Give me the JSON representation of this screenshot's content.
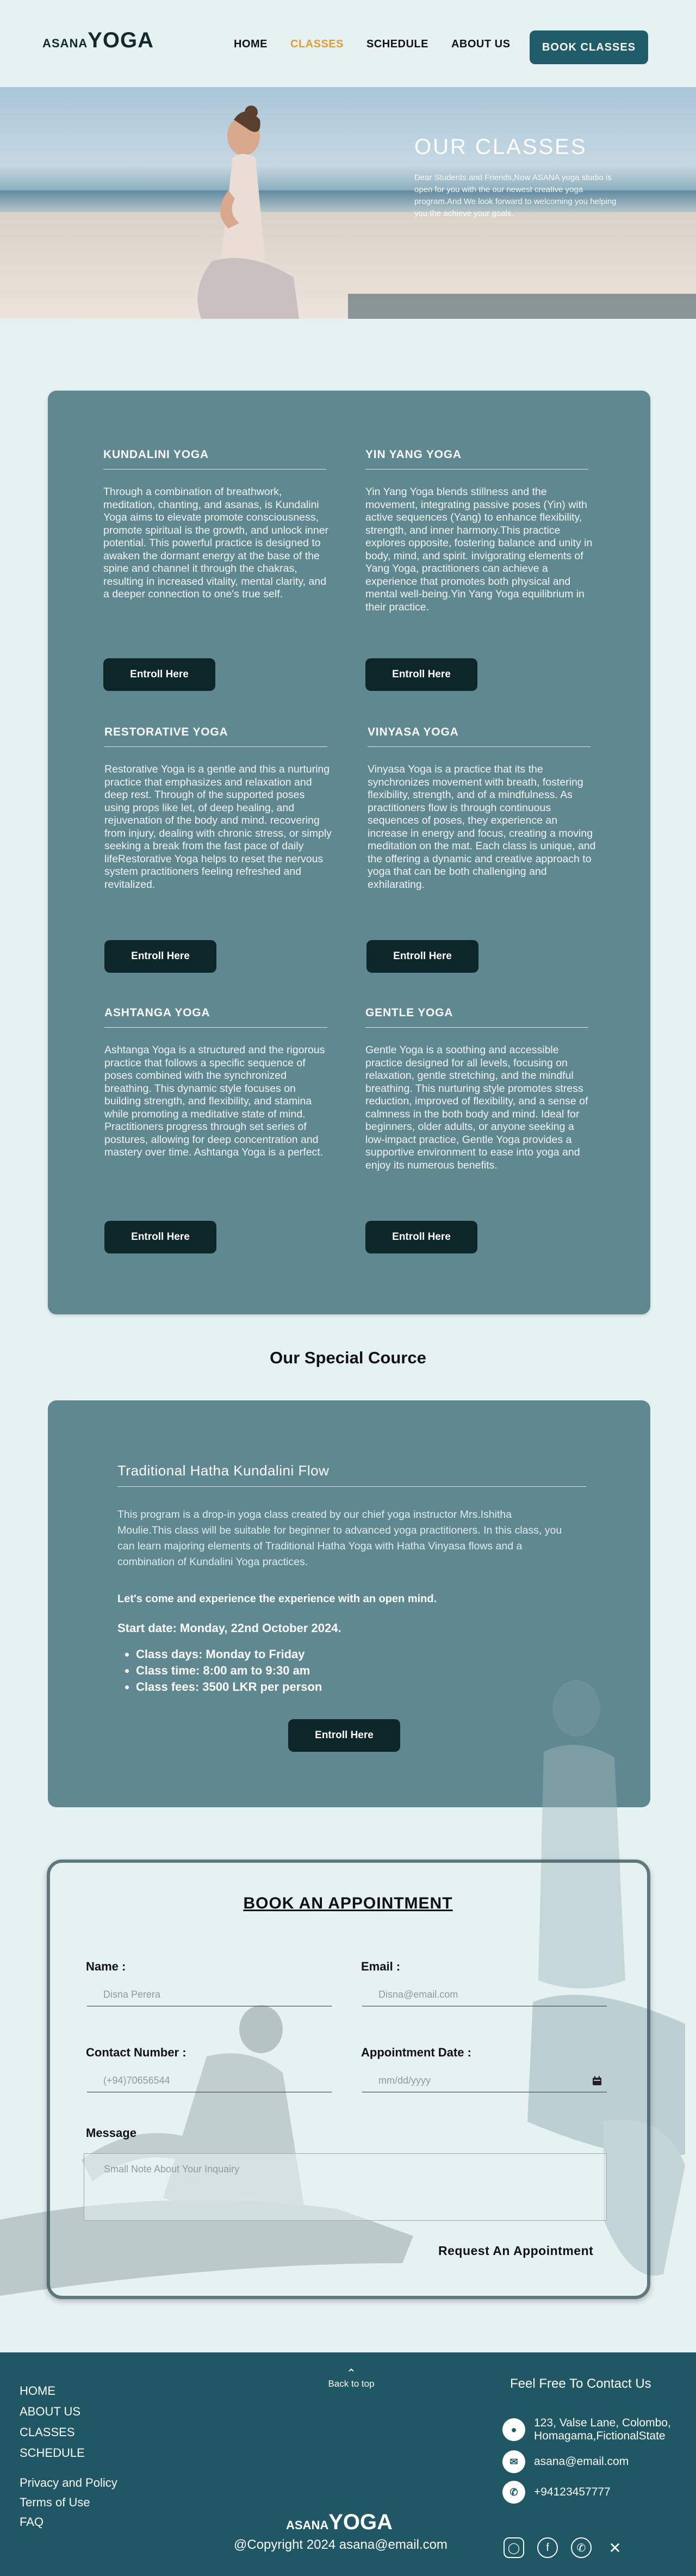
{
  "brand": {
    "small": "ASANA",
    "big": "YOGA"
  },
  "nav": {
    "items": [
      "HOME",
      "CLASSES",
      "SCHEDULE",
      "ABOUT US"
    ],
    "active": "CLASSES",
    "book": "BOOK  CLASSES"
  },
  "hero": {
    "title": "OUR  CLASSES",
    "text": "Dear Students and Friends,Now ASANA yoga studio is open for you with the our newest creative yoga program.And  We look forward to welcoming you helping you  the achieve your goals."
  },
  "classes": [
    {
      "name": "KUNDALINI YOGA",
      "desc": "Through a combination of breathwork, meditation, chanting, and asanas,  is Kundalini Yoga aims to elevate promote consciousness, promote spiritual  is the growth, and unlock inner potential. This powerful practice is designed to awaken the dormant energy at the base of the spine and channel it through the chakras, resulting in increased vitality, mental clarity, and a deeper connection to one's true self.",
      "button": "Entroll Here"
    },
    {
      "name": "YIN YANG YOGA",
      "desc": "Yin Yang Yoga blends stillness and the movement, integrating passive poses (Yin) with active sequences (Yang) to enhance flexibility, strength, and inner harmony.This practice explores opposite, fostering balance and unity in body, mind, and spirit.  invigorating elements of Yang Yoga, practitioners can achieve a experience that promotes both physical and mental well-being.Yin Yang Yoga equilibrium in their practice.",
      "button": "Entroll Here"
    },
    {
      "name": "RESTORATIVE YOGA",
      "desc": "Restorative Yoga is a gentle and this a nurturing practice that emphasizes  and relaxation and deep rest. Through of the supported poses using props like let, of deep healing, and rejuvenation of the body and mind.  recovering from injury, dealing with chronic stress, or simply seeking a break from the fast pace of daily lifeRestorative Yoga helps to reset the nervous system  practitioners feeling refreshed and revitalized.",
      "button": "Entroll Here"
    },
    {
      "name": "VINYASA YOGA",
      "desc": "Vinyasa Yoga is a practice that its the synchronizes movement with breath, fostering flexibility, strength, and  of a mindfulness. As practitioners flow  is through continuous sequences of poses, they experience an increase in energy and focus, creating a moving meditation on the mat. Each class is unique, and the  offering a dynamic and creative approach to yoga that can be both challenging and exhilarating.",
      "button": "Entroll Here"
    },
    {
      "name": "ASHTANGA YOGA",
      "desc": "Ashtanga Yoga is a structured and  the rigorous practice that follows a specific sequence of poses combined with the synchronized breathing. This dynamic style focuses on building strength, and flexibility, and stamina while promoting a meditative state of mind. Practitioners progress through set series of postures, allowing for deep concentration and mastery over time. Ashtanga Yoga is  a perfect.",
      "button": "Entroll Here"
    },
    {
      "name": "GENTLE YOGA",
      "desc": "Gentle Yoga is a soothing and accessible practice designed for all levels, focusing on relaxation, gentle stretching, and the mindful breathing. This nurturing style promotes stress reduction, improved  of flexibility, and a sense of calmness in the both body and mind. Ideal for beginners, older adults, or anyone seeking a low-impact practice, Gentle Yoga provides a supportive environment to ease into yoga and enjoy its numerous benefits.",
      "button": "Entroll Here"
    }
  ],
  "special": {
    "heading": "Our Special Cource",
    "title": "Traditional Hatha Kundalini Flow",
    "desc": "This program is a drop-in yoga class created by our  chief yoga instructor  Mrs.Ishitha Moulie.This class will be suitable for beginner to advanced yoga practitioners. In this class, you can learn majoring  elements of Traditional Hatha Yoga with Hatha Vinyasa flows and a combination of Kundalini Yoga practices.",
    "invite": "Let's come and experience the experience with an open mind.",
    "start": "Start date: Monday, 22nd October 2024.",
    "details": [
      "Class days: Monday to Friday",
      "Class time: 8:00 am to 9:30 am",
      "Class fees: 3500 LKR per person"
    ],
    "button": "Entroll Here"
  },
  "appointment": {
    "title": "BOOK AN APPOINTMENT",
    "name_label": "Name :",
    "name_placeholder": "Disna Perera",
    "email_label": "Email :",
    "email_placeholder": "Disna@email.com",
    "phone_label": "Contact Number :",
    "phone_placeholder": "(+94)70656544",
    "date_label": "Appointment Date :",
    "date_placeholder": "mm/dd/yyyy",
    "message_label": "Message",
    "message_placeholder": "Small Note About Your Inquairy",
    "submit": "Request An  Appointment"
  },
  "footer": {
    "links": [
      "HOME",
      "ABOUT US",
      "CLASSES",
      "SCHEDULE"
    ],
    "links2": [
      "Privacy and Policy",
      "Terms of Use",
      "FAQ"
    ],
    "back_to_top": "Back to top",
    "contact_title": "Feel Free To Contact Us",
    "address": "123, Valse Lane, Colombo, Homagama,FictionalState",
    "email": "asana@email.com",
    "phone": "+94123457777",
    "copyright": "@Copyright  2024 asana@email.com"
  }
}
